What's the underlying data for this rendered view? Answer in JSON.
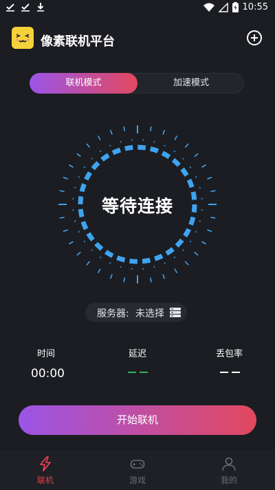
{
  "status_bar": {
    "time": "10:55"
  },
  "header": {
    "title": "像素联机平台"
  },
  "mode_switch": {
    "active_label": "联机模式",
    "inactive_label": "加速模式"
  },
  "dial": {
    "status_text": "等待连接"
  },
  "server": {
    "label": "服务器:",
    "value": "未选择"
  },
  "stats": {
    "time_label": "时间",
    "time_value": "00:00",
    "latency_label": "延迟",
    "loss_label": "丢包率"
  },
  "start_button": {
    "label": "开始联机"
  },
  "bottom_nav": {
    "items": [
      {
        "label": "联机"
      },
      {
        "label": "游戏"
      },
      {
        "label": "我的"
      }
    ]
  },
  "colors": {
    "accent_blue": "#3fa3f0",
    "latency_green": "#38b35a",
    "active_red": "#e2404f",
    "inactive_gray": "#6b6e75"
  }
}
